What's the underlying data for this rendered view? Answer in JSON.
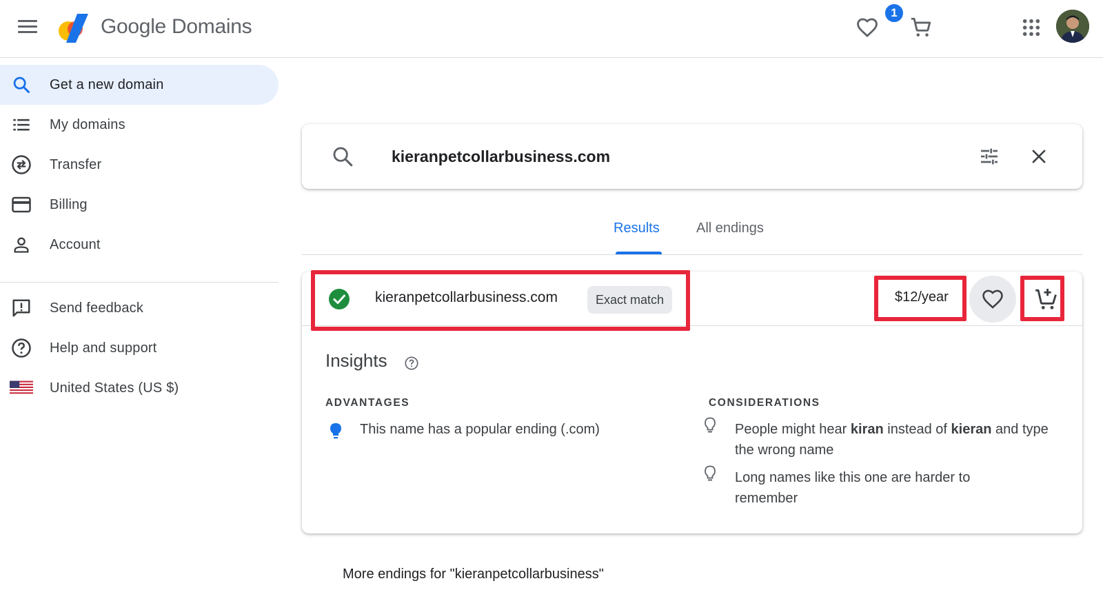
{
  "colors": {
    "accent": "#1a73e8",
    "highlight": "#e8263b",
    "success": "#1e8e3e",
    "active_nav_bg": "#e8f0fe"
  },
  "header": {
    "brand_google": "Google",
    "brand_product": "Domains",
    "favorites_badge": "1",
    "icons": [
      "menu-icon",
      "heart-icon",
      "cart-icon",
      "apps-grid-icon",
      "avatar"
    ]
  },
  "sidebar": {
    "items": [
      {
        "label": "Get a new domain",
        "icon": "search-icon",
        "active": true
      },
      {
        "label": "My domains",
        "icon": "list-icon"
      },
      {
        "label": "Transfer",
        "icon": "transfer-icon"
      },
      {
        "label": "Billing",
        "icon": "credit-card-icon"
      },
      {
        "label": "Account",
        "icon": "person-icon"
      }
    ],
    "secondary": [
      {
        "label": "Send feedback",
        "icon": "feedback-icon"
      },
      {
        "label": "Help and support",
        "icon": "help-icon"
      },
      {
        "label": "United States (US $)",
        "icon": "us-flag-icon"
      }
    ]
  },
  "search": {
    "value": "kieranpetcollarbusiness.com"
  },
  "tabs": [
    {
      "label": "Results",
      "active": true
    },
    {
      "label": "All endings",
      "active": false
    }
  ],
  "result": {
    "domain": "kieranpetcollarbusiness.com",
    "match_label": "Exact match",
    "price": "$12/year",
    "available": true
  },
  "insights": {
    "title": "Insights",
    "advantages_heading": "ADVANTAGES",
    "considerations_heading": "CONSIDERATIONS",
    "advantages": [
      "This name has a popular ending (.com)"
    ],
    "considerations": [
      {
        "before": "People might hear ",
        "b1": "kiran",
        "mid": " instead of ",
        "b2": "kieran",
        "after": " and type the wrong name"
      },
      {
        "text": "Long names like this one are harder to remember"
      }
    ]
  },
  "more_endings": "More endings for \"kieranpetcollarbusiness\""
}
